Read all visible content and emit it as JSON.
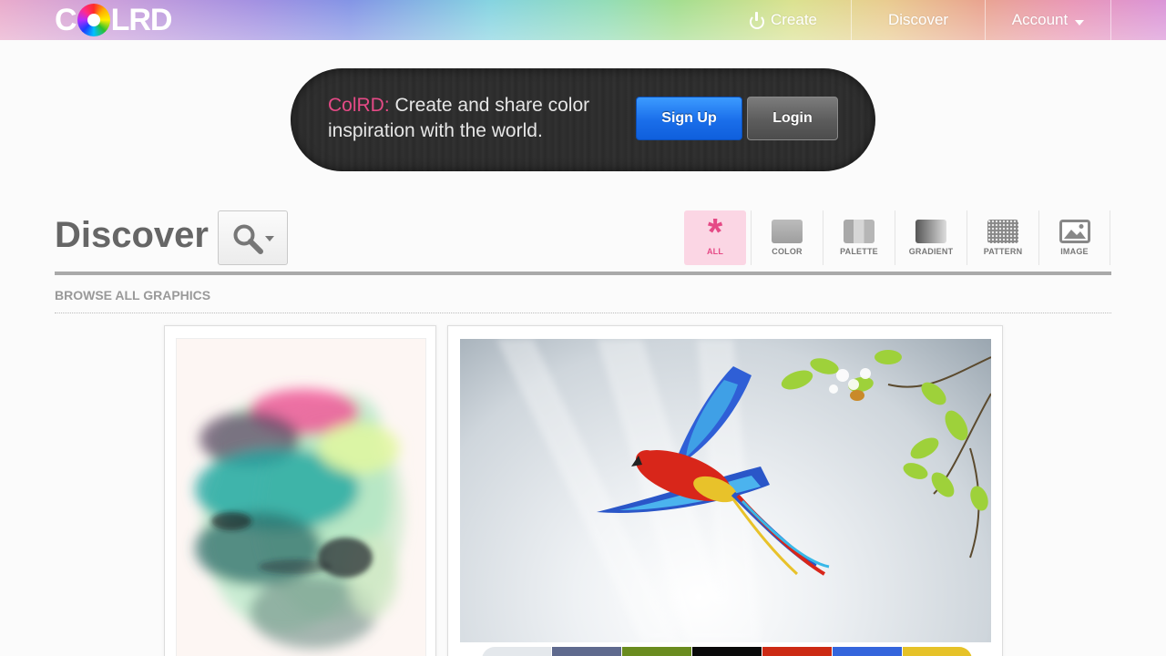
{
  "header": {
    "logo_prefix": "C",
    "logo_suffix": "LRD",
    "nav": [
      {
        "label": "Create",
        "icon": "power-icon"
      },
      {
        "label": "Discover"
      },
      {
        "label": "Account",
        "icon": "chevron-down-icon"
      }
    ]
  },
  "promo": {
    "brand": "ColRD:",
    "text": " Create and share color inspiration with the world.",
    "signup_label": "Sign Up",
    "login_label": "Login"
  },
  "discover": {
    "title": "Discover",
    "search_icon": "search-icon",
    "filters": [
      {
        "label": "ALL",
        "icon": "asterisk-icon",
        "active": true
      },
      {
        "label": "COLOR",
        "icon": "color-icon"
      },
      {
        "label": "PALETTE",
        "icon": "palette-icon"
      },
      {
        "label": "GRADIENT",
        "icon": "gradient-icon"
      },
      {
        "label": "PATTERN",
        "icon": "pattern-icon"
      },
      {
        "label": "IMAGE",
        "icon": "image-icon"
      }
    ],
    "browse_label": "BROWSE ALL GRAPHICS"
  },
  "cards": [
    {
      "type": "image",
      "subject": "watercolor-splash"
    },
    {
      "type": "image",
      "subject": "flying-parrot",
      "palette": [
        "#e4e8ec",
        "#5f6a8e",
        "#6a8c1f",
        "#0a0a0a",
        "#cc2a14",
        "#3465dc",
        "#e6c228"
      ]
    }
  ],
  "colors": {
    "accent_pink": "#e54a86",
    "signup_blue": "#1a6eea"
  }
}
